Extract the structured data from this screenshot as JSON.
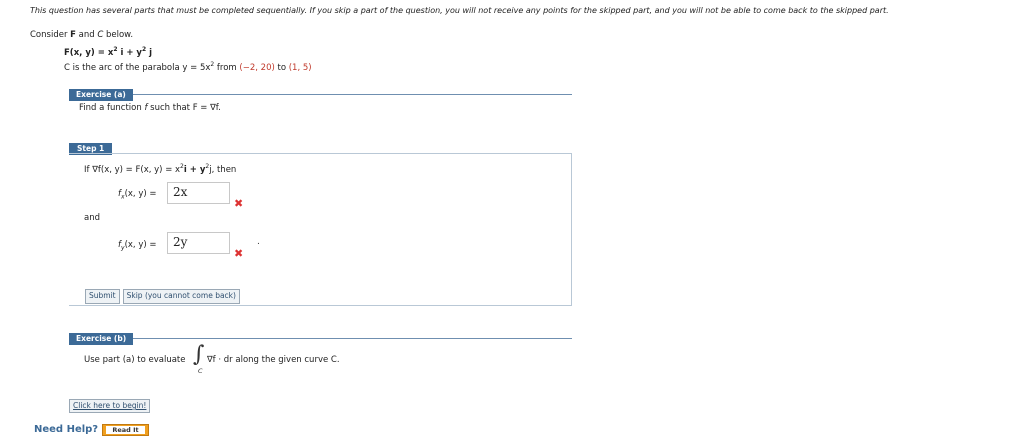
{
  "notice": "This question has several parts that must be completed sequentially. If you skip a part of the question, you will not receive any points for the skipped part, and you will not be able to come back to the skipped part.",
  "intro": {
    "consider_pre": "Consider ",
    "F": "F",
    "and": " and ",
    "C": "C",
    "below": " below.",
    "field_lhs": "F(x, y) = x",
    "field_exp1": "2",
    "field_i": " i + y",
    "field_exp2": "2",
    "field_j": " j",
    "curve_pre": "C is the arc of the parabola  y = 5x",
    "curve_exp": "2",
    "curve_mid": " from ",
    "curve_from": "(−2, 20)",
    "curve_to_word": " to ",
    "curve_to": "(1, 5)"
  },
  "exercise_a": {
    "tab": "Exercise (a)",
    "prompt_pre": "Find a function ",
    "prompt_f": "f",
    "prompt_post": " such that F = ∇f."
  },
  "step1": {
    "tab": "Step 1",
    "if_line_pre": "If  ∇f(x, y) = F(x, y) = x",
    "if_exp1": "2",
    "if_mid": "i + y",
    "if_exp2": "2",
    "if_post": "j,  then",
    "fx_label": "f",
    "fx_sub": "x",
    "fx_rest": "(x, y) =",
    "fx_value": "2x",
    "and": "and",
    "fy_label": "f",
    "fy_sub": "y",
    "fy_rest": "(x, y) =",
    "fy_value": "2y",
    "period": ".",
    "wrong_icon": "✖",
    "submit_label": "Submit",
    "skip_label": "Skip (you cannot come back)"
  },
  "exercise_b": {
    "tab": "Exercise (b)",
    "use_pre": "Use part (a) to evaluate",
    "integral_symbol": "∫",
    "integral_sub": "C",
    "use_post": "∇f · dr  along the given curve C.",
    "begin_label": "Click here to begin!"
  },
  "help": {
    "need_help": "Need Help?",
    "read_it": "Read It"
  },
  "colors": {
    "accent": "#3c6a97",
    "error": "#dd3333",
    "highlight": "#c0392b",
    "readit": "#f0a020"
  }
}
